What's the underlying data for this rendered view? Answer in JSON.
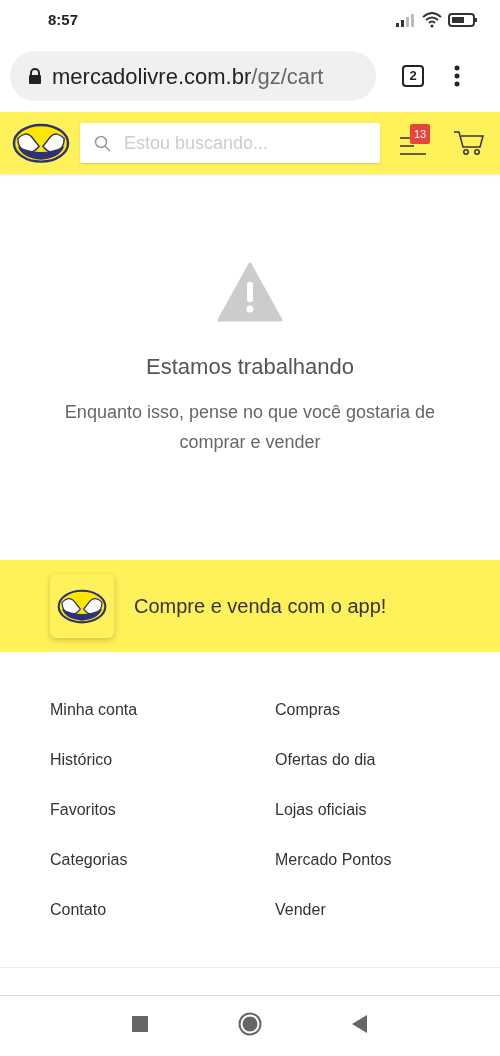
{
  "status_bar": {
    "time": "8:57"
  },
  "browser": {
    "url_host": "mercadolivre.com.br",
    "url_path": "/gz/cart",
    "tab_count": "2"
  },
  "header": {
    "search": {
      "placeholder": "Estou buscando..."
    },
    "menu_badge": "13"
  },
  "message": {
    "title": "Estamos trabalhando",
    "body": "Enquanto isso, pense no que você gostaria de comprar e vender"
  },
  "app_banner": {
    "text": "Compre e venda com o app!"
  },
  "footer_links": [
    {
      "label": "Minha conta"
    },
    {
      "label": "Compras"
    },
    {
      "label": "Histórico"
    },
    {
      "label": "Ofertas do dia"
    },
    {
      "label": "Favoritos"
    },
    {
      "label": "Lojas oficiais"
    },
    {
      "label": "Categorias"
    },
    {
      "label": "Mercado Pontos"
    },
    {
      "label": "Contato"
    },
    {
      "label": "Vender"
    }
  ]
}
